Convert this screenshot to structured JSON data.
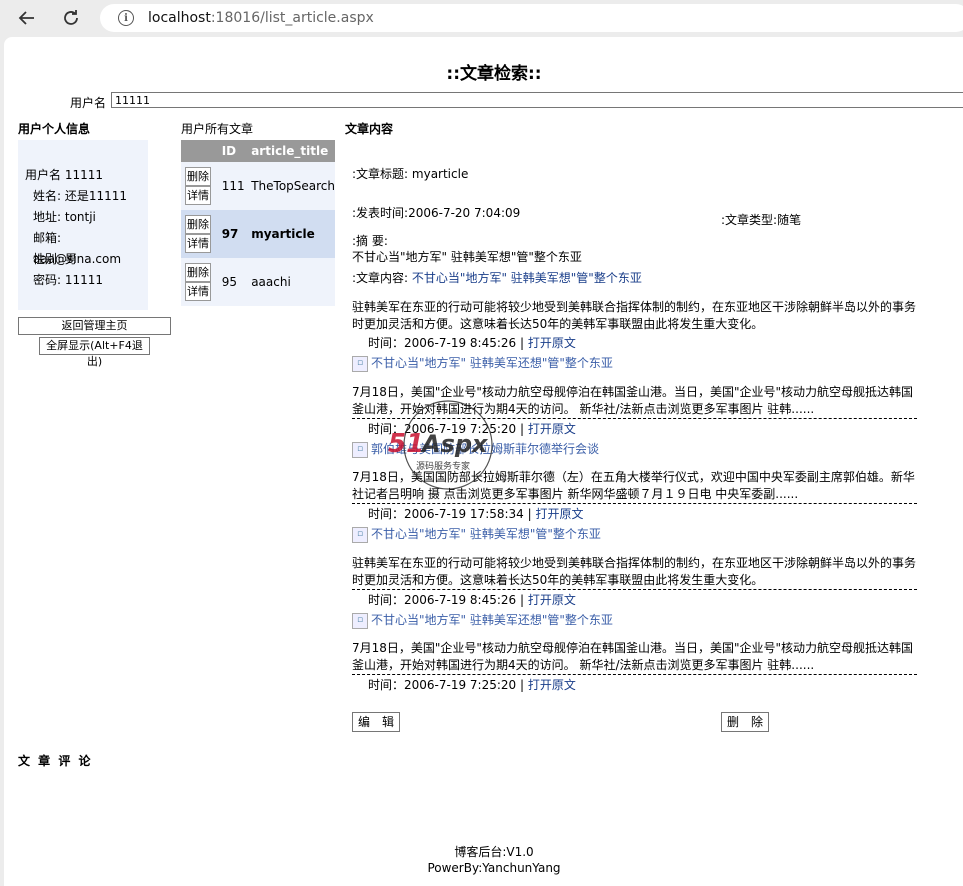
{
  "browser": {
    "url_host": "localhost",
    "url_rest": ":18016/list_article.aspx"
  },
  "page": {
    "title": "::文章检索::",
    "username_label": "用户名",
    "username_value": "11111"
  },
  "profile": {
    "heading": "用户个人信息",
    "rows": [
      "用户名 11111",
      "姓名: 还是11111",
      "地址: tontji",
      "邮箱: aaa@sina.com",
      "性别: 男",
      "密码: 11111"
    ],
    "home_button": "返回管理主页",
    "fullscreen_button": "全屏显示(Alt+F4退出)"
  },
  "articles": {
    "heading": "用户所有文章",
    "columns": [
      "",
      "ID",
      "article_title"
    ],
    "delete_label": "删除",
    "detail_label": "详情",
    "rows": [
      {
        "id": "111",
        "title": "TheTopSearch"
      },
      {
        "id": "97",
        "title": "myarticle"
      },
      {
        "id": "95",
        "title": "aaachi"
      }
    ]
  },
  "content": {
    "heading": "文章内容",
    "title_line": ":文章标题: myarticle",
    "date_line": ":发表时间:2006-7-20 7:04:09",
    "type_line": ":文章类型:随笔",
    "summary_label": ":摘 要:",
    "summary_text": "不甘心当\"地方军\" 驻韩美军想\"管\"整个东亚",
    "body_label": ":文章内容:",
    "body_link": "不甘心当\"地方军\" 驻韩美军想\"管\"整个东亚",
    "news": [
      {
        "text": "驻韩美军在东亚的行动可能将较少地受到美韩联合指挥体制的制约，在东亚地区干涉除朝鲜半岛以外的事务时更加灵活和方便。这意味着长达50年的美韩军事联盟由此将发生重大变化。",
        "time": "时间：2006-7-19 8:45:26",
        "open": "打开原文",
        "img": "不甘心当\"地方军\" 驻韩美军还想\"管\"整个东亚"
      },
      {
        "text": "7月18日，美国\"企业号\"核动力航空母舰停泊在韩国釜山港。当日，美国\"企业号\"核动力航空母舰抵达韩国釜山港，开始对韩国进行为期4天的访问。 新华社/法新点击浏览更多军事图片 驻韩......",
        "time": "时间：2006-7-19 7:25:20",
        "open": "打开原文",
        "img": "郭伯雄与美国防部长拉姆斯菲尔德举行会谈"
      },
      {
        "text": "7月18日，美国国防部长拉姆斯菲尔德（左）在五角大楼举行仪式，欢迎中国中央军委副主席郭伯雄。新华社记者吕明响 摄 点击浏览更多军事图片 新华网华盛顿７月１９日电 中央军委副......",
        "time": "时间：2006-7-19 17:58:34",
        "open": "打开原文",
        "img": "不甘心当\"地方军\" 驻韩美军想\"管\"整个东亚"
      },
      {
        "text": "驻韩美军在东亚的行动可能将较少地受到美韩联合指挥体制的制约，在东亚地区干涉除朝鲜半岛以外的事务时更加灵活和方便。这意味着长达50年的美韩军事联盟由此将发生重大变化。",
        "time": "时间：2006-7-19 8:45:26",
        "open": "打开原文",
        "img": "不甘心当\"地方军\" 驻韩美军还想\"管\"整个东亚"
      },
      {
        "text": "7月18日，美国\"企业号\"核动力航空母舰停泊在韩国釜山港。当日，美国\"企业号\"核动力航空母舰抵达韩国釜山港，开始对韩国进行为期4天的访问。 新华社/法新点击浏览更多军事图片 驻韩......",
        "time": "时间：2006-7-19 7:25:20",
        "open": "打开原文",
        "img": ""
      }
    ],
    "edit_button": "编　辑",
    "delete_button": "删　除"
  },
  "comments": {
    "heading": "文 章 评 论"
  },
  "footer": {
    "line1": "博客后台:V1.0",
    "line2": "PowerBy:YanchunYang"
  },
  "watermark": {
    "brand": "51Aspx",
    "tagline": "源码服务专家"
  },
  "colors": {
    "header_bg": "#999999",
    "row_bg": "#eff3fb",
    "selected_row_bg": "#d1ddf1",
    "link": "#1a3e8a"
  }
}
